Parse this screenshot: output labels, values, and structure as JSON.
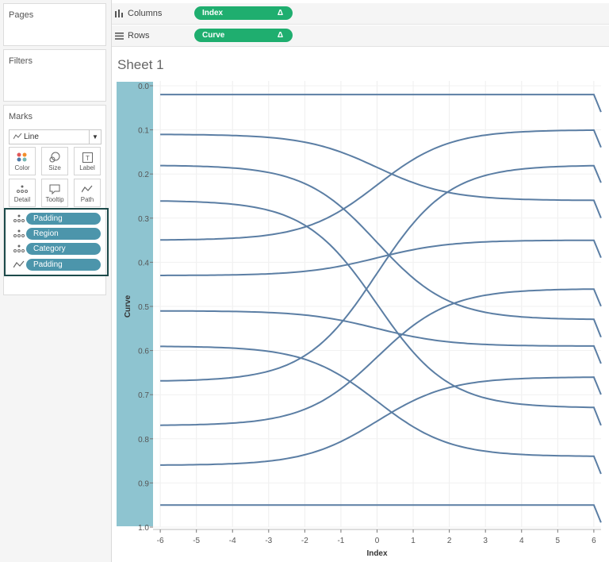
{
  "left_panel": {
    "pages_title": "Pages",
    "filters_title": "Filters",
    "marks": {
      "title": "Marks",
      "mark_type": "Line",
      "buttons": [
        {
          "label": "Color",
          "icon": "color-dots-icon"
        },
        {
          "label": "Size",
          "icon": "size-icon"
        },
        {
          "label": "Label",
          "icon": "label-icon"
        },
        {
          "label": "Detail",
          "icon": "detail-dots-icon"
        },
        {
          "label": "Tooltip",
          "icon": "tooltip-icon"
        },
        {
          "label": "Path",
          "icon": "path-icon"
        }
      ],
      "pills": [
        {
          "label": "Padding",
          "icon": "detail-dots-icon"
        },
        {
          "label": "Region",
          "icon": "detail-dots-icon"
        },
        {
          "label": "Category",
          "icon": "detail-dots-icon"
        },
        {
          "label": "Padding",
          "icon": "path-icon"
        }
      ]
    }
  },
  "shelves": {
    "columns_label": "Columns",
    "columns_pill": "Index",
    "rows_label": "Rows",
    "rows_pill": "Curve",
    "pill_delta": "Δ",
    "pill_color": "#1fae6f"
  },
  "sheet_title": "Sheet 1",
  "chart_data": {
    "type": "line",
    "xlabel": "Index",
    "ylabel": "Curve",
    "x_ticks": [
      "-6",
      "-5",
      "-4",
      "-3",
      "-2",
      "-1",
      "0",
      "1",
      "2",
      "3",
      "4",
      "5",
      "6"
    ],
    "y_ticks": [
      "0.0",
      "0.1",
      "0.2",
      "0.3",
      "0.4",
      "0.5",
      "0.6",
      "0.7",
      "0.8",
      "0.9",
      "1.0"
    ],
    "xlim": [
      -6.2,
      6.2
    ],
    "ylim": [
      0.0,
      1.0
    ],
    "line_color": "#5b7ea4",
    "axis_band_color": "#8ec4d0",
    "series": [
      {
        "start": 0.02,
        "end": 0.02
      },
      {
        "start": 0.11,
        "end": 0.26
      },
      {
        "start": 0.18,
        "end": 0.53
      },
      {
        "start": 0.26,
        "end": 0.73
      },
      {
        "start": 0.35,
        "end": 0.1
      },
      {
        "start": 0.43,
        "end": 0.35
      },
      {
        "start": 0.51,
        "end": 0.59
      },
      {
        "start": 0.59,
        "end": 0.84
      },
      {
        "start": 0.67,
        "end": 0.18
      },
      {
        "start": 0.77,
        "end": 0.46
      },
      {
        "start": 0.86,
        "end": 0.66
      },
      {
        "start": 0.95,
        "end": 0.95
      }
    ]
  }
}
